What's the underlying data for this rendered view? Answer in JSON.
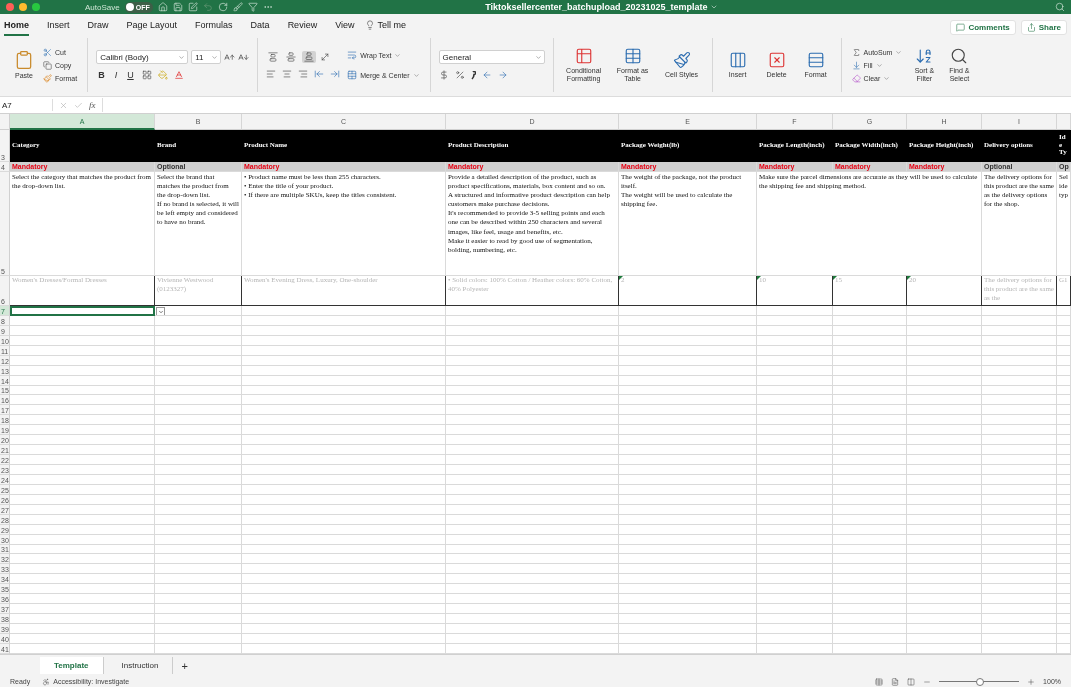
{
  "title_bar": {
    "autosave": {
      "label": "AutoSave",
      "state_text": "OFF",
      "on": false
    },
    "title": "Tiktoksellercenter_batchupload_20231025_template"
  },
  "ribbon_tabs": [
    {
      "label": "Home",
      "selected": true
    },
    {
      "label": "Insert",
      "selected": false
    },
    {
      "label": "Draw",
      "selected": false
    },
    {
      "label": "Page Layout",
      "selected": false
    },
    {
      "label": "Formulas",
      "selected": false
    },
    {
      "label": "Data",
      "selected": false
    },
    {
      "label": "Review",
      "selected": false
    },
    {
      "label": "View",
      "selected": false
    }
  ],
  "tell_me": "Tell me",
  "top_buttons": {
    "comments": "Comments",
    "share": "Share"
  },
  "ribbon": {
    "clipboard": {
      "paste": "Paste",
      "cut": "Cut",
      "copy": "Copy",
      "format": "Format"
    },
    "font": {
      "name": "Calibri (Body)",
      "size": "11",
      "bold": "B",
      "italic": "I",
      "underline": "U"
    },
    "vertical_alignment": [
      {
        "selected": false
      },
      {
        "selected": false
      },
      {
        "selected": true
      }
    ],
    "alignment": {
      "wrap": "Wrap Text",
      "merge": "Merge & Center"
    },
    "number": {
      "format": "General"
    },
    "styles": [
      "Conditional Formatting",
      "Format as Table",
      "Cell Styles"
    ],
    "cells": [
      "Insert",
      "Delete",
      "Format"
    ],
    "editing": {
      "autosum": "AutoSum",
      "fill": "Fill",
      "clear": "Clear",
      "sort": "Sort & Filter",
      "find": "Find & Select"
    }
  },
  "formula_bar": {
    "name_box": "A7",
    "fx": "fx"
  },
  "columns": [
    {
      "letter": "A",
      "selected": true
    },
    {
      "letter": "B",
      "selected": false
    },
    {
      "letter": "C",
      "selected": false
    },
    {
      "letter": "D",
      "selected": false
    },
    {
      "letter": "E",
      "selected": false
    },
    {
      "letter": "F",
      "selected": false
    },
    {
      "letter": "G",
      "selected": false
    },
    {
      "letter": "H",
      "selected": false
    },
    {
      "letter": "I",
      "selected": false
    },
    {
      "selected": false
    }
  ],
  "rows": [
    {
      "number": "3",
      "kind": "header",
      "selected": false,
      "cells": [
        "Category",
        "Brand",
        "Product Name",
        "Product Description",
        "Package Weight(lb)",
        "Package Length(inch)",
        "Package Width(inch)",
        "Package Height(inch)",
        "Delivery options",
        "Ide Ty"
      ]
    },
    {
      "number": "4",
      "kind": "requirement",
      "selected": false,
      "cells": [
        {
          "text": "Mandatory",
          "kind": "mandatory"
        },
        {
          "text": "Optional",
          "kind": "optional"
        },
        {
          "text": "Mandatory",
          "kind": "mandatory"
        },
        {
          "text": "Mandatory",
          "kind": "mandatory"
        },
        {
          "text": "Mandatory",
          "kind": "mandatory"
        },
        {
          "text": "Mandatory",
          "kind": "mandatory"
        },
        {
          "text": "Mandatory",
          "kind": "mandatory"
        },
        {
          "text": "Mandatory",
          "kind": "mandatory"
        },
        {
          "text": "Optional",
          "kind": "optional"
        },
        {
          "text": "Op",
          "kind": "optional"
        }
      ]
    },
    {
      "number": "5",
      "kind": "description",
      "selected": false,
      "cells": [
        {
          "text": "Select the category that matches the product from the drop-down list.",
          "merged": false
        },
        {
          "text": "Select the brand that matches the product from the drop-down list.\nIf no brand is selected, it will be left empty and considered to have no brand.",
          "merged": false
        },
        {
          "text": "• Product name must be less than 255 characters.\n• Enter the title of your product.\n• If there are multiple SKUs, keep the titles consistent.",
          "merged": false
        },
        {
          "text": "Provide a detailed description of the product, such as product specifications, materials, box content and so on.\nA structured and informative product description can help customers make purchase decisions.\nIt's recommended to provide 3-5 selling points and each one can be described within 250 characters and several images, like feel, usage and benefits, etc.\nMake it easier to read by good use of segmentation, bolding, numbering, etc.",
          "merged": false
        },
        {
          "text": "The weight of the package, not the product itself.\nThe weight will be used to calculate the shipping fee.",
          "merged": false
        },
        {
          "text": "Make sure the parcel dimensions are accurate as they will be used to calculate the shipping fee and shipping method.",
          "merged": false
        },
        {
          "text": "",
          "merged": true
        },
        {
          "text": "",
          "merged": true
        },
        {
          "text": "The delivery options for this product are the same as the delivery options for the shop.",
          "merged": false
        },
        {
          "text": "Sel ide typ",
          "merged": false
        }
      ]
    },
    {
      "number": "6",
      "kind": "example",
      "selected": false,
      "cells": [
        {
          "text": "Women's Dresses/Formal Dresses",
          "flag": false
        },
        {
          "text": "Vivienne Westwood (0123327)",
          "flag": false
        },
        {
          "text": "Women's Evening Dress, Luxury, One-shoulder",
          "flag": false
        },
        {
          "text": "• Solid colors: 100% Cotton / Heather colors: 60% Cotton, 40% Polyester",
          "flag": false
        },
        {
          "text": "2",
          "flag": true
        },
        {
          "text": "10",
          "flag": true
        },
        {
          "text": "15",
          "flag": true
        },
        {
          "text": "20",
          "flag": true
        },
        {
          "text": "The delivery options for this product are the same as the",
          "flag": false
        },
        {
          "text": "G1",
          "flag": false
        }
      ]
    },
    {
      "number": "7",
      "kind": "blank",
      "selected": true
    },
    {
      "number": "8",
      "kind": "blank",
      "selected": false
    },
    {
      "number": "9",
      "kind": "blank",
      "selected": false
    },
    {
      "number": "10",
      "kind": "blank",
      "selected": false
    },
    {
      "number": "11",
      "kind": "blank",
      "selected": false
    },
    {
      "number": "12",
      "kind": "blank",
      "selected": false
    },
    {
      "number": "13",
      "kind": "blank",
      "selected": false
    },
    {
      "number": "14",
      "kind": "blank",
      "selected": false
    },
    {
      "number": "15",
      "kind": "blank",
      "selected": false
    },
    {
      "number": "16",
      "kind": "blank",
      "selected": false
    },
    {
      "number": "17",
      "kind": "blank",
      "selected": false
    },
    {
      "number": "18",
      "kind": "blank",
      "selected": false
    },
    {
      "number": "19",
      "kind": "blank",
      "selected": false
    },
    {
      "number": "20",
      "kind": "blank",
      "selected": false
    },
    {
      "number": "21",
      "kind": "blank",
      "selected": false
    },
    {
      "number": "22",
      "kind": "blank",
      "selected": false
    },
    {
      "number": "23",
      "kind": "blank",
      "selected": false
    },
    {
      "number": "24",
      "kind": "blank",
      "selected": false
    },
    {
      "number": "25",
      "kind": "blank",
      "selected": false
    },
    {
      "number": "26",
      "kind": "blank",
      "selected": false
    },
    {
      "number": "27",
      "kind": "blank",
      "selected": false
    },
    {
      "number": "28",
      "kind": "blank",
      "selected": false
    },
    {
      "number": "29",
      "kind": "blank",
      "selected": false
    },
    {
      "number": "30",
      "kind": "blank",
      "selected": false
    },
    {
      "number": "31",
      "kind": "blank",
      "selected": false
    },
    {
      "number": "32",
      "kind": "blank",
      "selected": false
    },
    {
      "number": "33",
      "kind": "blank",
      "selected": false
    },
    {
      "number": "34",
      "kind": "blank",
      "selected": false
    },
    {
      "number": "35",
      "kind": "blank",
      "selected": false
    },
    {
      "number": "36",
      "kind": "blank",
      "selected": false
    },
    {
      "number": "37",
      "kind": "blank",
      "selected": false
    },
    {
      "number": "38",
      "kind": "blank",
      "selected": false
    },
    {
      "number": "39",
      "kind": "blank",
      "selected": false
    },
    {
      "number": "40",
      "kind": "blank",
      "selected": false
    },
    {
      "number": "41",
      "kind": "blank",
      "selected": false
    }
  ],
  "sheet_tabs": [
    {
      "label": "Template",
      "selected": true
    },
    {
      "label": "Instruction",
      "selected": false
    }
  ],
  "add_sheet": "+",
  "status_bar": {
    "status": "Ready",
    "accessibility": "Accessibility: Investigate",
    "zoom": {
      "level": 0.5,
      "reading": "100%"
    }
  }
}
